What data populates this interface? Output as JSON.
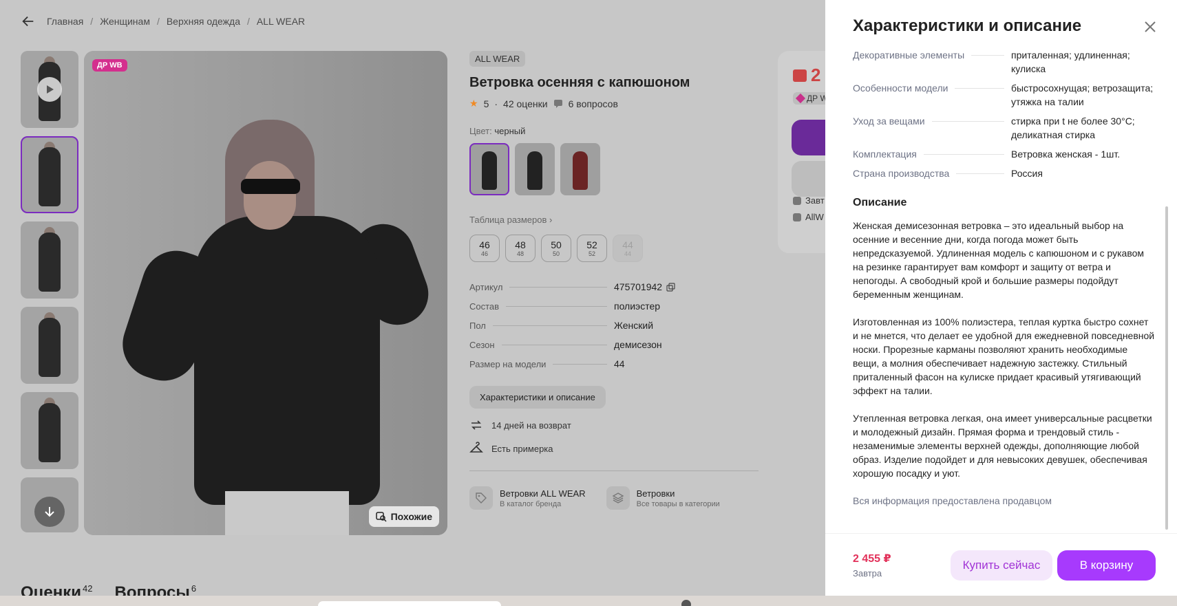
{
  "breadcrumbs": [
    "Главная",
    "Женщинам",
    "Верхняя одежда",
    "ALL WEAR"
  ],
  "photo": {
    "badge": "ДР WB",
    "similar_label": "Похожие"
  },
  "product": {
    "brand": "ALL WEAR",
    "title": "Ветровка осенняя с капюшоном",
    "rating": "5",
    "reviews": "42 оценки",
    "questions": "6 вопросов",
    "color_label": "Цвет:",
    "color_value": "черный",
    "size_table_link": "Таблица размеров",
    "sizes": [
      {
        "n": "46",
        "s": "46"
      },
      {
        "n": "48",
        "s": "48"
      },
      {
        "n": "50",
        "s": "50"
      },
      {
        "n": "52",
        "s": "52"
      },
      {
        "n": "44",
        "s": "44"
      }
    ],
    "specs": [
      {
        "k": "Артикул",
        "v": "475701942"
      },
      {
        "k": "Состав",
        "v": "полиэстер"
      },
      {
        "k": "Пол",
        "v": "Женский"
      },
      {
        "k": "Сезон",
        "v": "демисезон"
      },
      {
        "k": "Размер на модели",
        "v": "44"
      }
    ],
    "char_button": "Характеристики и описание",
    "features": [
      "14 дней на возврат",
      "Есть примерка"
    ],
    "categories": [
      {
        "title": "Ветровки ALL WEAR",
        "sub": "В каталог бренда"
      },
      {
        "title": "Ветровки",
        "sub": "Все товары в категории"
      }
    ]
  },
  "buybox": {
    "price_partial": "2",
    "dr_partial": "ДР W",
    "delivery_partial": "Завт",
    "seller_partial": "AllW"
  },
  "bottom_tabs": [
    {
      "label": "Оценки",
      "count": "42"
    },
    {
      "label": "Вопросы",
      "count": "6"
    }
  ],
  "drawer": {
    "title": "Характеристики и описание",
    "specs": [
      {
        "k": "Декоративные элементы",
        "v": "приталенная; удлиненная; кулиска"
      },
      {
        "k": "Особенности модели",
        "v": "быстросохнущая; ветрозащита; утяжка на талии"
      },
      {
        "k": "Уход за вещами",
        "v": "стирка при t не более 30°C; деликатная стирка"
      },
      {
        "k": "Комплектация",
        "v": "Ветровка женская - 1шт."
      },
      {
        "k": "Страна производства",
        "v": "Россия"
      }
    ],
    "description_title": "Описание",
    "paragraphs": [
      "Женская демисезонная ветровка – это идеальный выбор на осенние и весенние дни, когда погода может быть непредсказуемой. Удлиненная модель с капюшоном и с рукавом на резинке гарантирует вам комфорт и защиту от ветра и непогоды. А свободный крой и большие размеры подойдут беременным женщинам.",
      "Изготовленная из 100% полиэстера, теплая куртка быстро сохнет и не мнется, что делает ее удобной для ежедневной повседневной носки. Прорезные карманы позволяют хранить необходимые вещи, а молния обеспечивает надежную застежку. Стильный приталенный фасон на кулиске придает красивый утягивающий эффект на талии.",
      "Утепленная ветровка легкая, она имеет универсальные расцветки и молодежный дизайн. Прямая форма и трендовый стиль - незаменимые элементы верхней одежды, дополняющие любой образ. Изделие подойдет и для невысоких девушек, обеспечивая хорошую посадку и уют."
    ],
    "seller_note": "Вся информация предоставлена продавцом",
    "footer": {
      "price": "2 455 ₽",
      "delivery": "Завтра",
      "buy_now": "Купить сейчас",
      "to_cart": "В корзину"
    }
  },
  "colors": {
    "accent": "#a73afd",
    "price": "#e2315a",
    "badge": "#d42f8e"
  }
}
